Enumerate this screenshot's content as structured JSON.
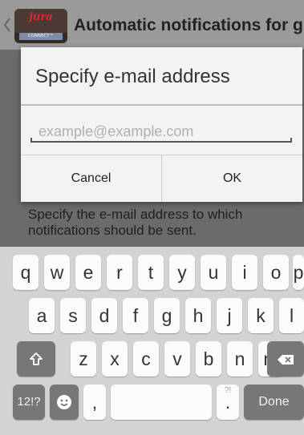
{
  "action_bar": {
    "title": "Automatic notifications for g...",
    "logo_wordmark": "jura",
    "logo_tagline": "CONNECT™"
  },
  "background": {
    "help_text": "Specify the e-mail address to which notifications should be sent."
  },
  "dialog": {
    "title": "Specify e-mail address",
    "email_placeholder": "example@example.com",
    "email_value": "",
    "cancel_label": "Cancel",
    "ok_label": "OK"
  },
  "keyboard": {
    "row1": [
      "q",
      "w",
      "e",
      "r",
      "t",
      "y",
      "u",
      "i",
      "o",
      "p"
    ],
    "row2": [
      "a",
      "s",
      "d",
      "f",
      "g",
      "h",
      "j",
      "k",
      "l"
    ],
    "row3": [
      "z",
      "x",
      "c",
      "v",
      "b",
      "n",
      "m"
    ],
    "shift_icon": "shift-arrow-icon",
    "backspace_icon": "backspace-icon",
    "symbols_label": "12!?",
    "emoji_icon": "smiley-icon",
    "comma_label": ",",
    "period_label": ".",
    "period_hint": "?!",
    "done_label": "Done"
  },
  "colors": {
    "dim_overlay": "#6b6b6b",
    "action_bar": "#9a9a9a",
    "dialog_bg": "#f3f3f3",
    "keyboard_bg": "#d3d3d3",
    "dark_key": "#777777",
    "brand_red": "#e3262c"
  }
}
